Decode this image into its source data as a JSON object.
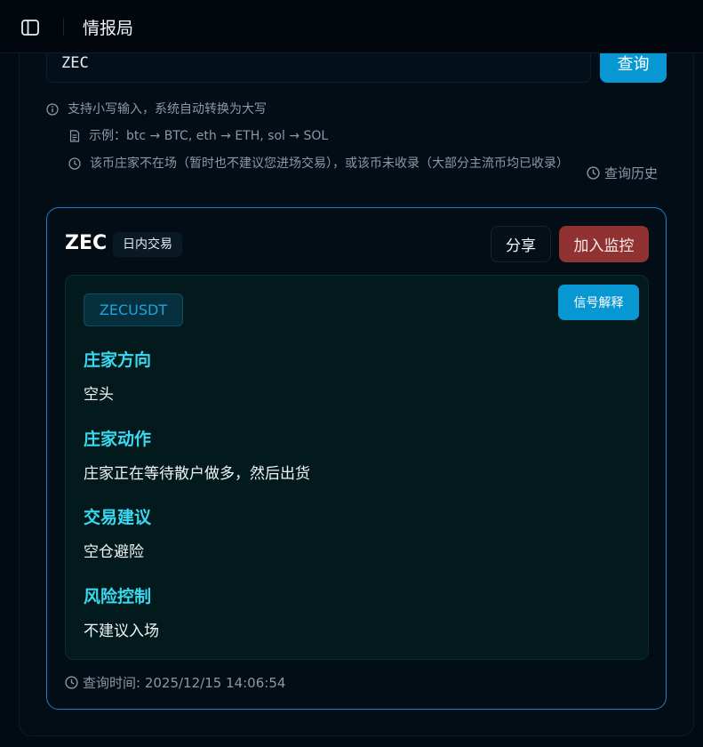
{
  "app": {
    "title": "情报局"
  },
  "search": {
    "value": "ZEC",
    "button_label": "查询"
  },
  "hints": {
    "lowercase": "支持小写输入，系统自动转换为大写",
    "example": "示例：btc → BTC, eth → ETH, sol → SOL",
    "notice": "该币庄家不在场（暂时也不建议您进场交易），或该币未收录（大部分主流币均已收录）"
  },
  "history_link": "查询历史",
  "result": {
    "coin": "ZEC",
    "type_badge": "日内交易",
    "share_label": "分享",
    "monitor_label": "加入监控",
    "pair": "ZECUSDT",
    "explain_label": "信号解释",
    "sections": [
      {
        "title": "庄家方向",
        "value": "空头"
      },
      {
        "title": "庄家动作",
        "value": "庄家正在等待散户做多，然后出货"
      },
      {
        "title": "交易建议",
        "value": "空仓避险"
      },
      {
        "title": "风险控制",
        "value": "不建议入场"
      }
    ],
    "query_time": "查询时间: 2025/12/15 14:06:54"
  },
  "icons": {
    "sidebar_toggle": "sidebar-toggle-icon",
    "info": "info-icon",
    "document": "document-icon",
    "clock": "clock-icon"
  },
  "colors": {
    "accent_blue": "#0797d3",
    "monitor_red": "#913232",
    "section_title_cyan": "#3ad9f0",
    "card_border": "#1f7fd0"
  }
}
